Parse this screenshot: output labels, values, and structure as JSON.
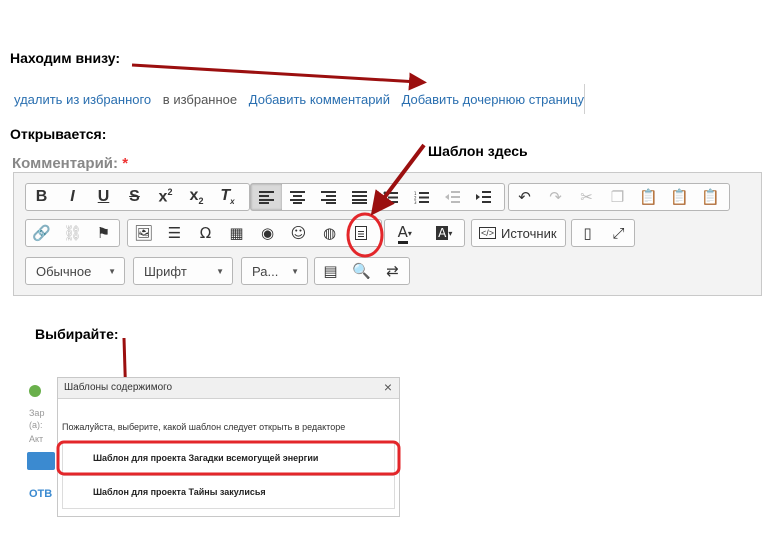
{
  "captions": {
    "find_below": "Находим внизу:",
    "opens": "Открывается:",
    "template_here": "Шаблон здесь",
    "choose": "Выбирайте:"
  },
  "links": {
    "remove_favorite": "удалить из избранного",
    "to_favorite": "в избранное",
    "add_comment": "Добавить комментарий",
    "add_child_page": "Добавить дочернюю страницу"
  },
  "comment": {
    "label": "Комментарий:",
    "required_mark": "*"
  },
  "toolbar": {
    "source_label": "Источник",
    "format_combo": "Обычное",
    "font_combo": "Шрифт",
    "size_combo": "Ра..."
  },
  "dialog": {
    "title": "Шаблоны содержимого",
    "close": "×",
    "prompt": "Пожалуйста, выберите, какой шаблон следует открыть в редакторе",
    "templates": [
      "Шаблон для проекта Загадки всемогущей энергии",
      "Шаблон для проекта Тайны закулисья"
    ]
  },
  "background_fragments": {
    "a": "Зар",
    "b": "(а):",
    "c": "Акт",
    "d": "ОТВ"
  },
  "colors": {
    "arrow": "#9b0f0f",
    "highlight": "#e3262a",
    "link": "#2a6fb0"
  }
}
